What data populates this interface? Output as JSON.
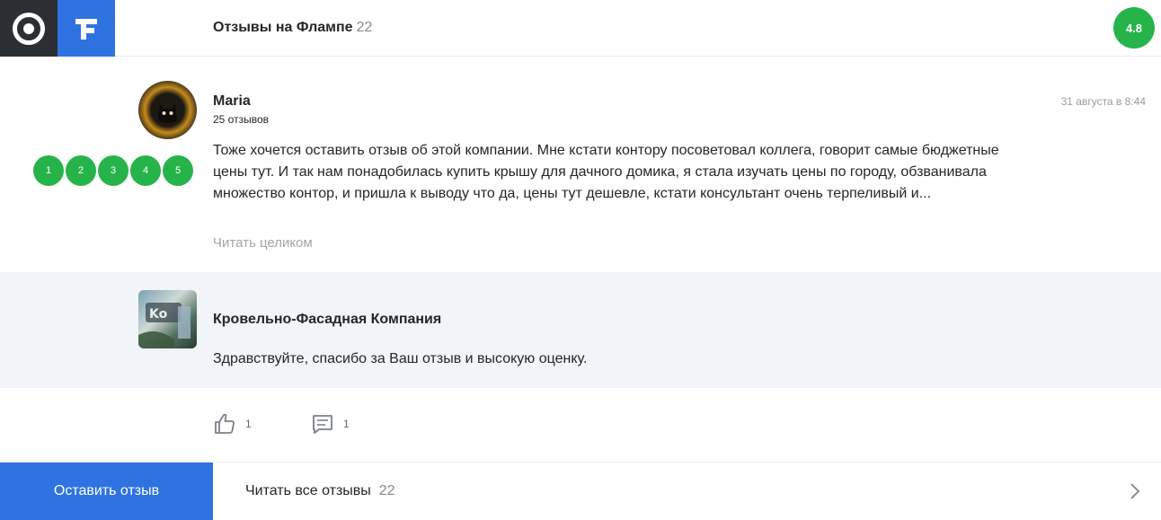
{
  "header": {
    "title": "Отзывы на Флампе",
    "count": "22",
    "rating": "4.8"
  },
  "review": {
    "author": "Maria",
    "author_reviews": "25 отзывов",
    "date": "31 августа в 8:44",
    "text": "Тоже хочется оставить отзыв об этой компании. Мне кстати контору посоветовал коллега, говорит самые бюджетные цены тут. И так нам понадобилась купить крышу для дачного домика, я стала изучать цены по городу, обзванивала множество контор, и пришла к выводу что да, цены тут дешевле, кстати консультант очень терпеливый и...",
    "read_more": "Читать целиком",
    "rating_dots": [
      "1",
      "2",
      "3",
      "4",
      "5"
    ]
  },
  "reply": {
    "company": "Кровельно-Фасадная Компания",
    "text": "Здравствуйте, спасибо за Ваш отзыв и высокую оценку."
  },
  "actions": {
    "likes": "1",
    "comments": "1"
  },
  "footer": {
    "leave_review": "Оставить отзыв",
    "read_all": "Читать все отзывы",
    "read_all_count": "22"
  },
  "colors": {
    "accent_blue": "#2f73e0",
    "rating_green": "#26b44a",
    "dark_logo": "#2b2f33",
    "reply_bg": "#f1f4f9"
  }
}
